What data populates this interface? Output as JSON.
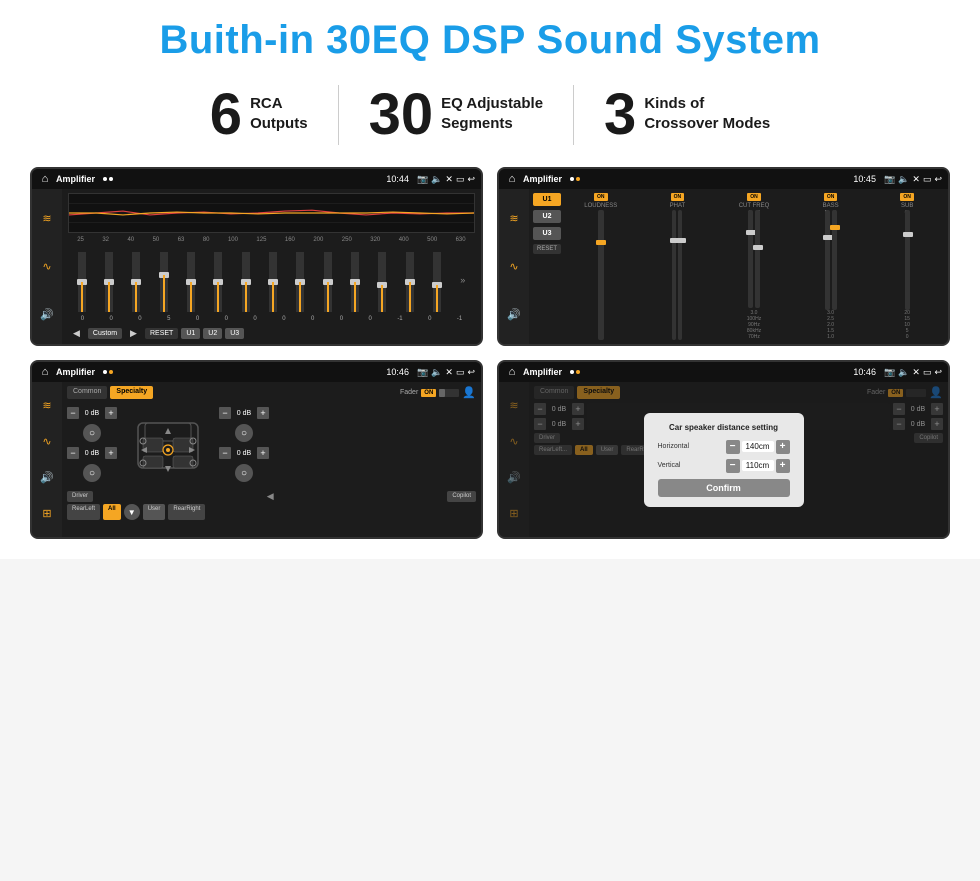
{
  "title": "Buith-in 30EQ DSP Sound System",
  "stats": [
    {
      "number": "6",
      "label": "RCA",
      "sublabel": "Outputs"
    },
    {
      "number": "30",
      "label": "EQ Adjustable",
      "sublabel": "Segments"
    },
    {
      "number": "3",
      "label": "Kinds of",
      "sublabel": "Crossover Modes"
    }
  ],
  "screens": [
    {
      "id": "screen1",
      "status_title": "Amplifier",
      "time": "10:44",
      "type": "eq",
      "freqs": [
        "25",
        "32",
        "40",
        "50",
        "63",
        "80",
        "100",
        "125",
        "160",
        "200",
        "250",
        "320",
        "400",
        "500",
        "630"
      ],
      "values": [
        "0",
        "0",
        "0",
        "5",
        "0",
        "0",
        "0",
        "0",
        "0",
        "0",
        "0",
        "-1",
        "0",
        "-1"
      ],
      "controls": [
        "◀",
        "Custom",
        "▶",
        "RESET",
        "U1",
        "U2",
        "U3"
      ]
    },
    {
      "id": "screen2",
      "status_title": "Amplifier",
      "time": "10:45",
      "type": "amp2",
      "presets": [
        "U1",
        "U2",
        "U3"
      ],
      "channels": [
        {
          "name": "LOUDNESS",
          "on": true
        },
        {
          "name": "PHAT",
          "on": true
        },
        {
          "name": "CUT FREQ",
          "on": true
        },
        {
          "name": "BASS",
          "on": true
        },
        {
          "name": "SUB",
          "on": true
        }
      ]
    },
    {
      "id": "screen3",
      "status_title": "Amplifier",
      "time": "10:46",
      "type": "speaker",
      "tabs": [
        "Common",
        "Specialty"
      ],
      "active_tab": 1,
      "fader_label": "Fader",
      "fader_on": true,
      "db_values": [
        "0 dB",
        "0 dB",
        "0 dB",
        "0 dB"
      ],
      "bottom_btns": [
        "Driver",
        "",
        "Copilot",
        "RearLeft",
        "All",
        "",
        "User",
        "RearRight"
      ]
    },
    {
      "id": "screen4",
      "status_title": "Amplifier",
      "time": "10:46",
      "type": "speaker_dialog",
      "dialog_title": "Car speaker distance setting",
      "fields": [
        {
          "label": "Horizontal",
          "value": "140cm"
        },
        {
          "label": "Vertical",
          "value": "110cm"
        }
      ],
      "confirm_label": "Confirm",
      "db_right_values": [
        "0 dB",
        "0 dB"
      ],
      "bottom_btns_right": [
        "Driver",
        "Copilot",
        "RearLeft",
        "RearRight"
      ]
    }
  ]
}
